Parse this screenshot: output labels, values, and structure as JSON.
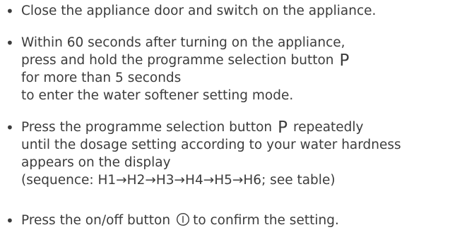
{
  "instructions": {
    "bullet": "•",
    "step1": {
      "line1": "Close the appliance door and switch on the appliance."
    },
    "step2": {
      "line1": "Within 60 seconds after turning on the appliance,",
      "line2": "press and hold the programme selection button",
      "line3": "for more than 5 seconds",
      "line4": "to enter the water softener setting mode."
    },
    "step3": {
      "line1": "Press the programme selection button",
      "line1_end": "repeatedly",
      "line2": "until the dosage setting according to your water hardness",
      "line3": "appears on the display",
      "line4": "(sequence: H1→H2→H3→H4→H5→H6; see table)"
    },
    "step4": {
      "line1": "Press the on/off button",
      "line1_end": "to confirm the setting."
    },
    "program_button_symbol": "P",
    "icons": {
      "program_button": "letter-p-icon",
      "power_button": "power-button-icon"
    }
  }
}
